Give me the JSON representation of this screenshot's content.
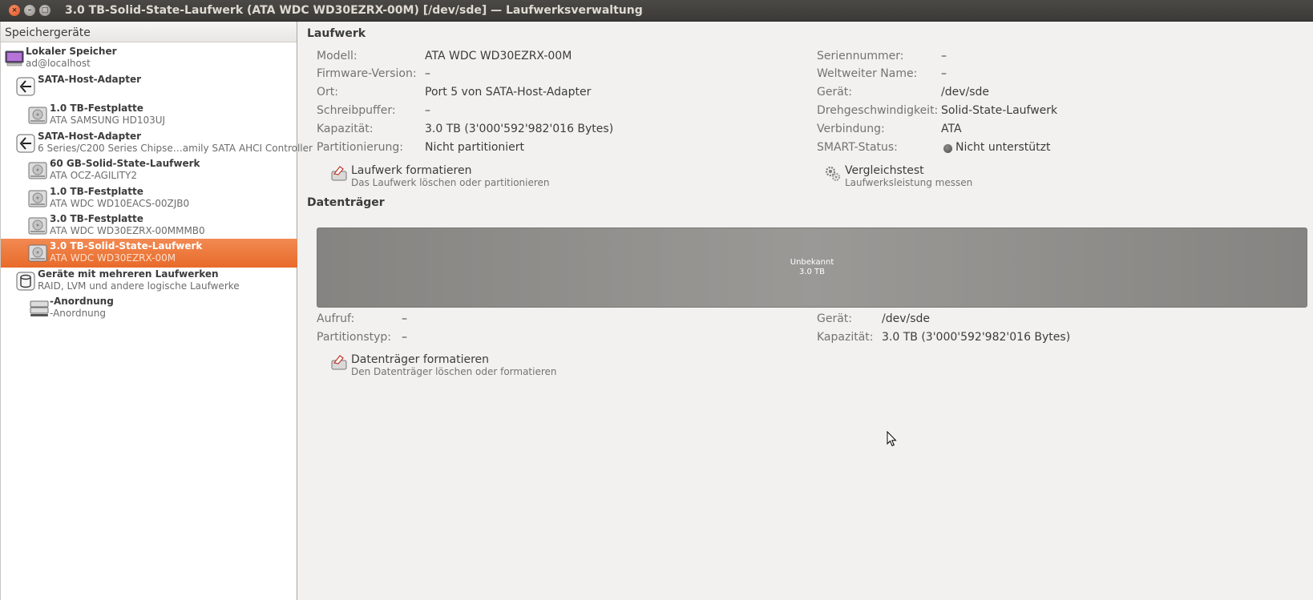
{
  "window": {
    "title": "3.0 TB-Solid-State-Laufwerk (ATA WDC WD30EZRX-00M) [/dev/sde] — Laufwerksverwaltung",
    "close_glyph": "×",
    "min_glyph": "–",
    "max_glyph": "□"
  },
  "sidebar": {
    "header": "Speichergeräte",
    "items": [
      {
        "title": "Lokaler Speicher",
        "subtitle": "ad@localhost",
        "icon": "computer-icon"
      },
      {
        "title": "SATA-Host-Adapter",
        "subtitle": "",
        "icon": "controller-icon"
      },
      {
        "title": "1.0 TB-Festplatte",
        "subtitle": "ATA SAMSUNG HD103UJ",
        "icon": "hard-disk-icon"
      },
      {
        "title": "SATA-Host-Adapter",
        "subtitle": "6 Series/C200 Series Chipse…amily SATA AHCI Controller",
        "icon": "controller-icon"
      },
      {
        "title": "60 GB-Solid-State-Laufwerk",
        "subtitle": "ATA OCZ-AGILITY2",
        "icon": "hard-disk-icon"
      },
      {
        "title": "1.0 TB-Festplatte",
        "subtitle": "ATA WDC WD10EACS-00ZJB0",
        "icon": "hard-disk-icon"
      },
      {
        "title": "3.0 TB-Festplatte",
        "subtitle": "ATA WDC WD30EZRX-00MMMB0",
        "icon": "hard-disk-icon"
      },
      {
        "title": "3.0 TB-Solid-State-Laufwerk",
        "subtitle": "ATA WDC WD30EZRX-00M",
        "icon": "hard-disk-icon",
        "selected": true
      },
      {
        "title": "Geräte mit mehreren Laufwerken",
        "subtitle": "RAID, LVM und andere logische Laufwerke",
        "icon": "multi-disk-icon"
      },
      {
        "title": "-Anordnung",
        "subtitle": "-Anordnung",
        "icon": "raid-array-icon"
      }
    ]
  },
  "drive": {
    "section_title": "Laufwerk",
    "left": [
      {
        "label": "Modell:",
        "value": "ATA WDC WD30EZRX-00M"
      },
      {
        "label": "Firmware-Version:",
        "value": "–"
      },
      {
        "label": "Ort:",
        "value": "Port 5 von SATA-Host-Adapter"
      },
      {
        "label": "Schreibpuffer:",
        "value": "–"
      },
      {
        "label": "Kapazität:",
        "value": "3.0 TB (3'000'592'982'016 Bytes)"
      },
      {
        "label": "Partitionierung:",
        "value": "Nicht partitioniert"
      }
    ],
    "right": [
      {
        "label": "Seriennummer:",
        "value": "–"
      },
      {
        "label": "Weltweiter Name:",
        "value": "–"
      },
      {
        "label": "Gerät:",
        "value": "/dev/sde"
      },
      {
        "label": "Drehgeschwindigkeit:",
        "value": "Solid-State-Laufwerk"
      },
      {
        "label": "Verbindung:",
        "value": "ATA"
      },
      {
        "label": "SMART-Status:",
        "value": "Nicht unterstützt"
      }
    ],
    "actions": [
      {
        "label": "Laufwerk formatieren",
        "sublabel": "Das Laufwerk löschen oder partitionieren",
        "icon": "format-drive-icon"
      },
      {
        "label": "Vergleichstest",
        "sublabel": "Laufwerksleistung messen",
        "icon": "benchmark-gears-icon"
      }
    ]
  },
  "volumes": {
    "section_title": "Datenträger",
    "bar": {
      "name": "Unbekannt",
      "size": "3.0 TB"
    },
    "left": [
      {
        "label": "Aufruf:",
        "value": "–"
      },
      {
        "label": "Partitionstyp:",
        "value": "–"
      }
    ],
    "right": [
      {
        "label": "Gerät:",
        "value": "/dev/sde"
      },
      {
        "label": "Kapazität:",
        "value": "3.0 TB (3'000'592'982'016 Bytes)"
      }
    ],
    "actions": [
      {
        "label": "Datenträger formatieren",
        "sublabel": "Den Datenträger löschen oder formatieren",
        "icon": "format-volume-icon"
      }
    ]
  }
}
